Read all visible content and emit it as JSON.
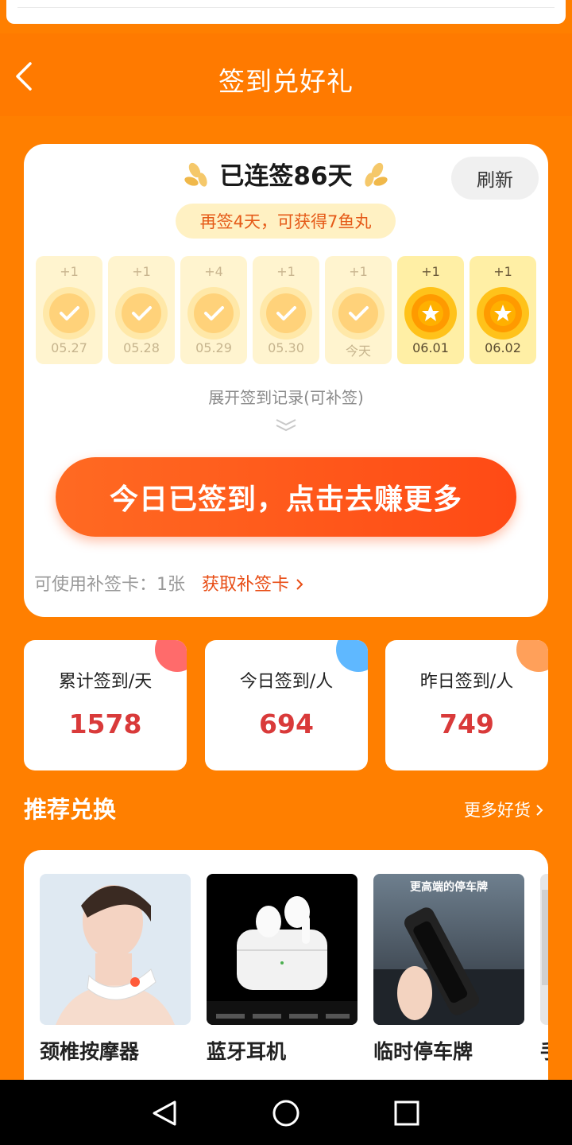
{
  "header": {
    "title": "签到兑好礼"
  },
  "checkin": {
    "streak_title": "已连签86天",
    "refresh_label": "刷新",
    "bonus_text": "再签4天，可获得7鱼丸",
    "days": [
      {
        "points": "+1",
        "date": "05.27",
        "status": "checked"
      },
      {
        "points": "+1",
        "date": "05.28",
        "status": "checked"
      },
      {
        "points": "+4",
        "date": "05.29",
        "status": "checked"
      },
      {
        "points": "+1",
        "date": "05.30",
        "status": "checked"
      },
      {
        "points": "+1",
        "date": "今天",
        "status": "checked"
      },
      {
        "points": "+1",
        "date": "06.01",
        "status": "upcoming"
      },
      {
        "points": "+1",
        "date": "06.02",
        "status": "upcoming"
      }
    ],
    "expand_label": "展开签到记录(可补签)",
    "main_button": "今日已签到，点击去赚更多",
    "makeup_label": "可使用补签卡：1张",
    "makeup_link": "获取补签卡"
  },
  "stats": [
    {
      "label": "累计签到/天",
      "value": "1578",
      "accent": "#ff6b6b"
    },
    {
      "label": "今日签到/人",
      "value": "694",
      "accent": "#5fb8ff"
    },
    {
      "label": "昨日签到/人",
      "value": "749",
      "accent": "#ffa05a"
    }
  ],
  "recommend": {
    "title": "推荐兑换",
    "more_label": "更多好货",
    "products": [
      {
        "name": "颈椎按摩器",
        "image": "neck-massager"
      },
      {
        "name": "蓝牙耳机",
        "image": "earbuds"
      },
      {
        "name": "临时停车牌",
        "image": "parking-sign",
        "image_text": "更高端的停车牌"
      },
      {
        "name": "手",
        "image": "partial-product"
      }
    ]
  },
  "colors": {
    "background": "#ff7f00",
    "accent_red": "#e84d15",
    "value_red": "#d93a3a",
    "coin_gold": "#ffb000"
  }
}
